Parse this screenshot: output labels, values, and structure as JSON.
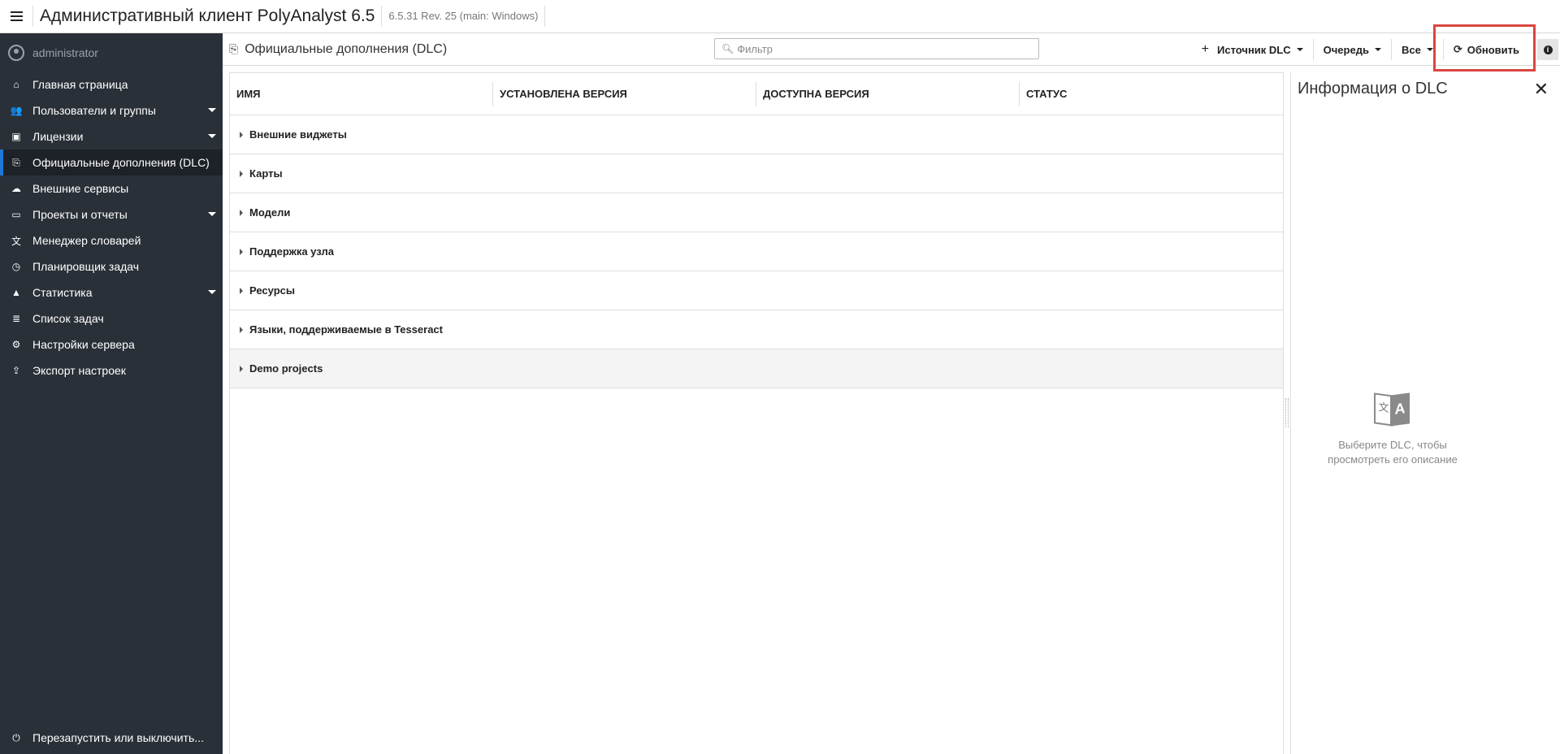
{
  "app": {
    "title": "Административный клиент PolyAnalyst 6.5",
    "version": "6.5.31 Rev. 25 (main: Windows)"
  },
  "sidebar": {
    "user": "administrator",
    "items": [
      {
        "label": "Главная страница",
        "icon": "home-icon",
        "glyph": "⌂",
        "dropdown": false
      },
      {
        "label": "Пользователи и группы",
        "icon": "users-icon",
        "glyph": "👥",
        "dropdown": true
      },
      {
        "label": "Лицензии",
        "icon": "license-icon",
        "glyph": "▣",
        "dropdown": true
      },
      {
        "label": "Официальные дополнения (DLC)",
        "icon": "dlc-icon",
        "glyph": "⎘",
        "dropdown": false,
        "active": true
      },
      {
        "label": "Внешние сервисы",
        "icon": "services-icon",
        "glyph": "☁",
        "dropdown": false
      },
      {
        "label": "Проекты и отчеты",
        "icon": "folder-icon",
        "glyph": "▭",
        "dropdown": true
      },
      {
        "label": "Менеджер словарей",
        "icon": "dictionary-icon",
        "glyph": "文",
        "dropdown": false
      },
      {
        "label": "Планировщик задач",
        "icon": "clock-icon",
        "glyph": "◷",
        "dropdown": false
      },
      {
        "label": "Статистика",
        "icon": "chart-icon",
        "glyph": "▲",
        "dropdown": true
      },
      {
        "label": "Список задач",
        "icon": "task-list-icon",
        "glyph": "≣",
        "dropdown": false
      },
      {
        "label": "Настройки сервера",
        "icon": "server-settings-icon",
        "glyph": "⚙",
        "dropdown": false
      },
      {
        "label": "Экспорт настроек",
        "icon": "export-icon",
        "glyph": "⇪",
        "dropdown": false
      }
    ],
    "bottom": {
      "label": "Перезапустить или выключить...",
      "icon": "power-icon",
      "glyph": "⏻"
    }
  },
  "toolbar": {
    "title": "Официальные дополнения (DLC)",
    "filter_placeholder": "Фильтр",
    "source_label": "Источник DLC",
    "queue_label": "Очередь",
    "all_label": "Все",
    "refresh_label": "Обновить"
  },
  "grid": {
    "columns": [
      "ИМЯ",
      "УСТАНОВЛЕНА ВЕРСИЯ",
      "ДОСТУПНА ВЕРСИЯ",
      "СТАТУС"
    ],
    "groups": [
      "Внешние виджеты",
      "Карты",
      "Модели",
      "Поддержка узла",
      "Ресурсы",
      "Языки, поддерживаемые в Tesseract",
      "Demo projects"
    ]
  },
  "info_panel": {
    "title": "Информация о DLC",
    "placeholder": "Выберите DLC, чтобы просмотреть его описание"
  },
  "colors": {
    "sidebar_bg": "#2a3038",
    "active_accent": "#1e78d7",
    "highlight": "#d9463f"
  }
}
